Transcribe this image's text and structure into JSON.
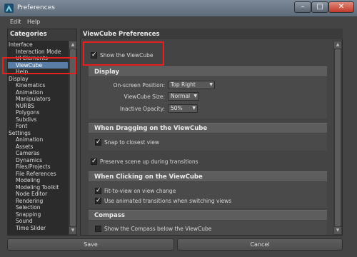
{
  "window": {
    "title": "Preferences"
  },
  "menubar": {
    "items": [
      "Edit",
      "Help"
    ]
  },
  "left": {
    "header": "Categories",
    "items": [
      {
        "label": "Interface",
        "indent": 0
      },
      {
        "label": "Interaction Mode",
        "indent": 1
      },
      {
        "label": "UI Elements",
        "indent": 1
      },
      {
        "label": "ViewCube",
        "indent": 1,
        "selected": true
      },
      {
        "label": "Help",
        "indent": 1
      },
      {
        "label": "Display",
        "indent": 0
      },
      {
        "label": "Kinematics",
        "indent": 1
      },
      {
        "label": "Animation",
        "indent": 1
      },
      {
        "label": "Manipulators",
        "indent": 1
      },
      {
        "label": "NURBS",
        "indent": 1
      },
      {
        "label": "Polygons",
        "indent": 1
      },
      {
        "label": "Subdivs",
        "indent": 1
      },
      {
        "label": "Font",
        "indent": 1
      },
      {
        "label": "Settings",
        "indent": 0
      },
      {
        "label": "Animation",
        "indent": 1
      },
      {
        "label": "Assets",
        "indent": 1
      },
      {
        "label": "Cameras",
        "indent": 1
      },
      {
        "label": "Dynamics",
        "indent": 1
      },
      {
        "label": "Files/Projects",
        "indent": 1
      },
      {
        "label": "File References",
        "indent": 1
      },
      {
        "label": "Modeling",
        "indent": 1
      },
      {
        "label": "Modeling Toolkit",
        "indent": 1
      },
      {
        "label": "Node Editor",
        "indent": 1
      },
      {
        "label": "Rendering",
        "indent": 1
      },
      {
        "label": "Selection",
        "indent": 1
      },
      {
        "label": "Snapping",
        "indent": 1
      },
      {
        "label": "Sound",
        "indent": 1
      },
      {
        "label": "Time Slider",
        "indent": 1
      }
    ]
  },
  "right": {
    "header": "ViewCube Preferences",
    "show_viewcube": {
      "label": "Show the ViewCube",
      "checked": true
    },
    "display": {
      "title": "Display",
      "position_label": "On-screen Position:",
      "position_value": "Top Right",
      "size_label": "ViewCube Size:",
      "size_value": "Normal",
      "opacity_label": "Inactive Opacity:",
      "opacity_value": "50%"
    },
    "dragging": {
      "title": "When Dragging on the ViewCube",
      "snap_label": "Snap to closest view",
      "snap_checked": true
    },
    "preserve": {
      "label": "Preserve scene up during transitions",
      "checked": true
    },
    "clicking": {
      "title": "When Clicking on the ViewCube",
      "fit_label": "Fit-to-view on view change",
      "fit_checked": true,
      "animated_label": "Use animated transitions when switching views",
      "animated_checked": true
    },
    "compass": {
      "title": "Compass",
      "show_label": "Show the Compass below the ViewCube",
      "show_checked": false
    }
  },
  "buttons": {
    "save": "Save",
    "cancel": "Cancel"
  },
  "colors": {
    "highlight_red": "#e81f1f",
    "selection_blue": "#5a7da5"
  }
}
